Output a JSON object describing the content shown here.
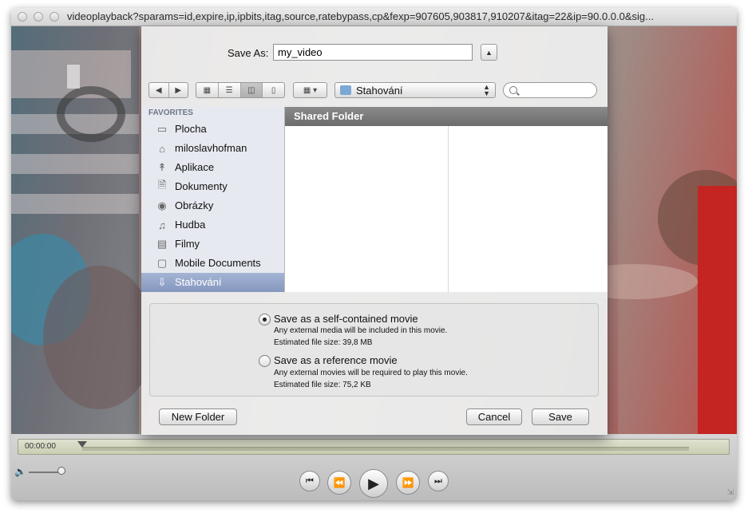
{
  "window": {
    "title": "videoplayback?sparams=id,expire,ip,ipbits,itag,source,ratebypass,cp&fexp=907605,903817,910207&itag=22&ip=90.0.0.0&sig..."
  },
  "player": {
    "timecode": "00:00:00"
  },
  "dialog": {
    "save_as_label": "Save As:",
    "filename": "my_video",
    "location": "Stahování",
    "sidebar": {
      "header": "FAVORITES",
      "items": [
        {
          "label": "Plocha",
          "icon": "desktop-icon"
        },
        {
          "label": "miloslavhofman",
          "icon": "home-icon"
        },
        {
          "label": "Aplikace",
          "icon": "applications-icon"
        },
        {
          "label": "Dokumenty",
          "icon": "documents-icon"
        },
        {
          "label": "Obrázky",
          "icon": "camera-icon"
        },
        {
          "label": "Hudba",
          "icon": "music-icon"
        },
        {
          "label": "Filmy",
          "icon": "film-icon"
        },
        {
          "label": "Mobile Documents",
          "icon": "folder-icon"
        },
        {
          "label": "Stahování",
          "icon": "downloads-icon",
          "selected": true
        }
      ]
    },
    "column_header": "Shared Folder",
    "options": {
      "self_contained": {
        "label": "Save as a self-contained movie",
        "desc": "Any external media will be included in this movie.",
        "size": "Estimated file size:  39,8 MB",
        "selected": true
      },
      "reference": {
        "label": "Save as a reference movie",
        "desc": "Any external movies will be required to play this movie.",
        "size": "Estimated file size:  75,2 KB",
        "selected": false
      }
    },
    "buttons": {
      "new_folder": "New Folder",
      "cancel": "Cancel",
      "save": "Save"
    }
  }
}
